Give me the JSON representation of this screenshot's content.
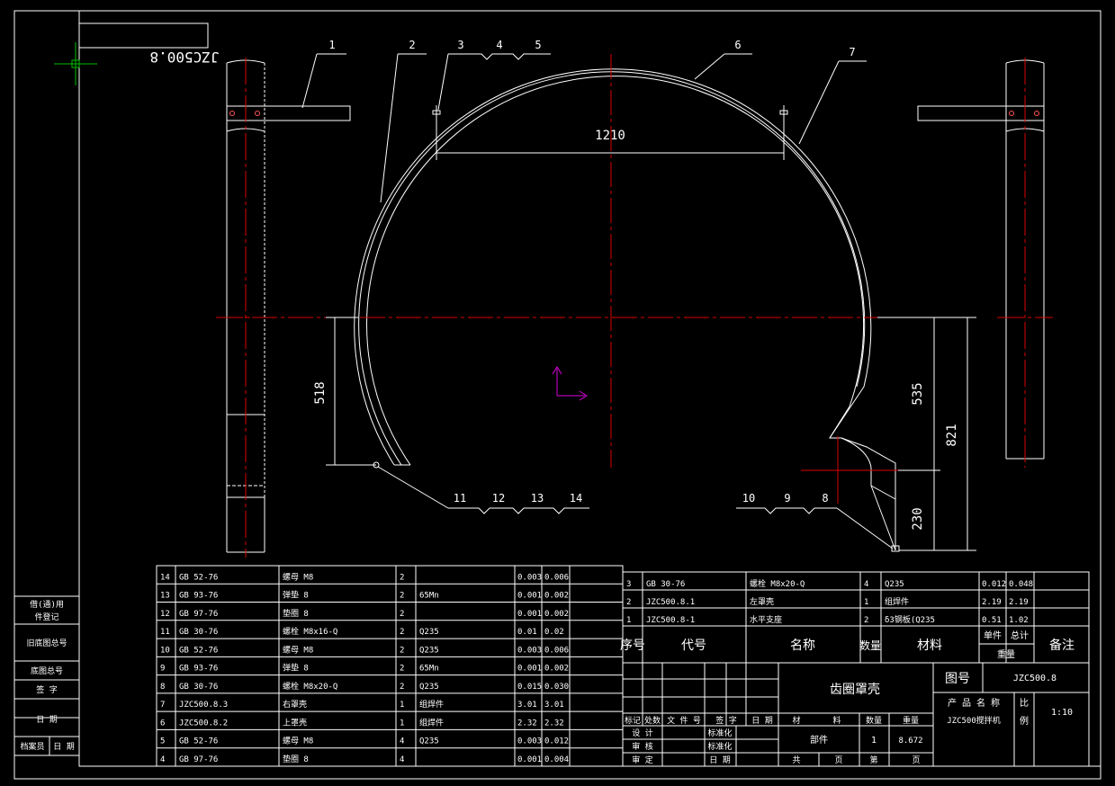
{
  "drawing": {
    "code_mirrored": "JZC500.8",
    "dim_1210": "1210",
    "dim_518": "518",
    "dim_535": "535",
    "dim_821": "821",
    "dim_230": "230",
    "balloons_top": [
      "1",
      "2",
      "3",
      "4",
      "5",
      "6",
      "7"
    ],
    "balloons_left": [
      "11",
      "12",
      "13",
      "14"
    ],
    "balloons_right": [
      "10",
      "9",
      "8"
    ]
  },
  "left_sidebar": {
    "row1": [
      "借(通)用",
      "件登记"
    ],
    "row2": "旧底图总号",
    "row3": "底图总号",
    "row4": "签 字",
    "row5": "日 期",
    "row6": [
      "档案员",
      "日 期"
    ]
  },
  "bom_left": {
    "rows": [
      {
        "no": "14",
        "code": "GB 52-76",
        "name": "螺母 M8",
        "qty": "2",
        "mat": "",
        "w1": "0.003",
        "w2": "0.006"
      },
      {
        "no": "13",
        "code": "GB 93-76",
        "name": "弹垫 8",
        "qty": "2",
        "mat": "65Mn",
        "w1": "0.001",
        "w2": "0.002"
      },
      {
        "no": "12",
        "code": "GB 97-76",
        "name": "垫圈 8",
        "qty": "2",
        "mat": "",
        "w1": "0.001",
        "w2": "0.002"
      },
      {
        "no": "11",
        "code": "GB 30-76",
        "name": "螺栓 M8x16-Q",
        "qty": "2",
        "mat": "Q235",
        "w1": "0.01",
        "w2": "0.02"
      },
      {
        "no": "10",
        "code": "GB 52-76",
        "name": "螺母 M8",
        "qty": "2",
        "mat": "Q235",
        "w1": "0.003",
        "w2": "0.006"
      },
      {
        "no": "9",
        "code": "GB 93-76",
        "name": "弹垫 8",
        "qty": "2",
        "mat": "65Mn",
        "w1": "0.001",
        "w2": "0.002"
      },
      {
        "no": "8",
        "code": "GB 30-76",
        "name": "螺栓 M8x20-Q",
        "qty": "2",
        "mat": "Q235",
        "w1": "0.015",
        "w2": "0.030"
      },
      {
        "no": "7",
        "code": "JZC500.8.3",
        "name": "右罩壳",
        "qty": "1",
        "mat": "组焊件",
        "w1": "3.01",
        "w2": "3.01"
      },
      {
        "no": "6",
        "code": "JZC500.8.2",
        "name": "上罩壳",
        "qty": "1",
        "mat": "组焊件",
        "w1": "2.32",
        "w2": "2.32"
      },
      {
        "no": "5",
        "code": "GB 52-76",
        "name": "螺母 M8",
        "qty": "4",
        "mat": "Q235",
        "w1": "0.003",
        "w2": "0.012"
      },
      {
        "no": "4",
        "code": "GB 97-76",
        "name": "垫圈 8",
        "qty": "4",
        "mat": "",
        "w1": "0.001",
        "w2": "0.004"
      }
    ]
  },
  "bom_right": {
    "rows": [
      {
        "no": "3",
        "code": "GB 30-76",
        "name": "螺栓 M8x20-Q",
        "qty": "4",
        "mat": "Q235",
        "w1": "0.012",
        "w2": "0.048"
      },
      {
        "no": "2",
        "code": "JZC500.8.1",
        "name": "左罩壳",
        "qty": "1",
        "mat": "组焊件",
        "w1": "2.19",
        "w2": "2.19"
      },
      {
        "no": "1",
        "code": "JZC500.8-1",
        "name": "水平支座",
        "qty": "2",
        "mat": "δ3钢板(Q235",
        "w1": "0.51",
        "w2": "1.02"
      }
    ],
    "header": {
      "no": "序号",
      "code": "代号",
      "name": "名称",
      "qty": "数量",
      "mat": "材料",
      "single": "单件",
      "total": "总计",
      "weight": "重量",
      "remark": "备注"
    }
  },
  "title_block": {
    "title": "齿圈罩壳",
    "drawing_no_label": "图号",
    "drawing_no": "JZC500.8",
    "product_label": "产 品 名 称",
    "product": "JZC500搅拌机",
    "scale_label": [
      "比",
      "例"
    ],
    "scale": "1:10",
    "rev_headers": [
      "标记",
      "处数",
      "文 件 号",
      "签 字",
      "日 期"
    ],
    "mat_label": "材",
    "mat_label2": "料",
    "qty_label": "数量",
    "weight_label": "重量",
    "part_label": "部件",
    "qty_val": "1",
    "weight_val": "8.672",
    "sign_rows": [
      [
        "设 计",
        "",
        "标准化",
        ""
      ],
      [
        "审 核",
        "",
        "标准化",
        ""
      ],
      [
        "审 定",
        "",
        "日 期",
        ""
      ]
    ],
    "sheet": [
      "共",
      "页",
      "第",
      "页"
    ]
  }
}
